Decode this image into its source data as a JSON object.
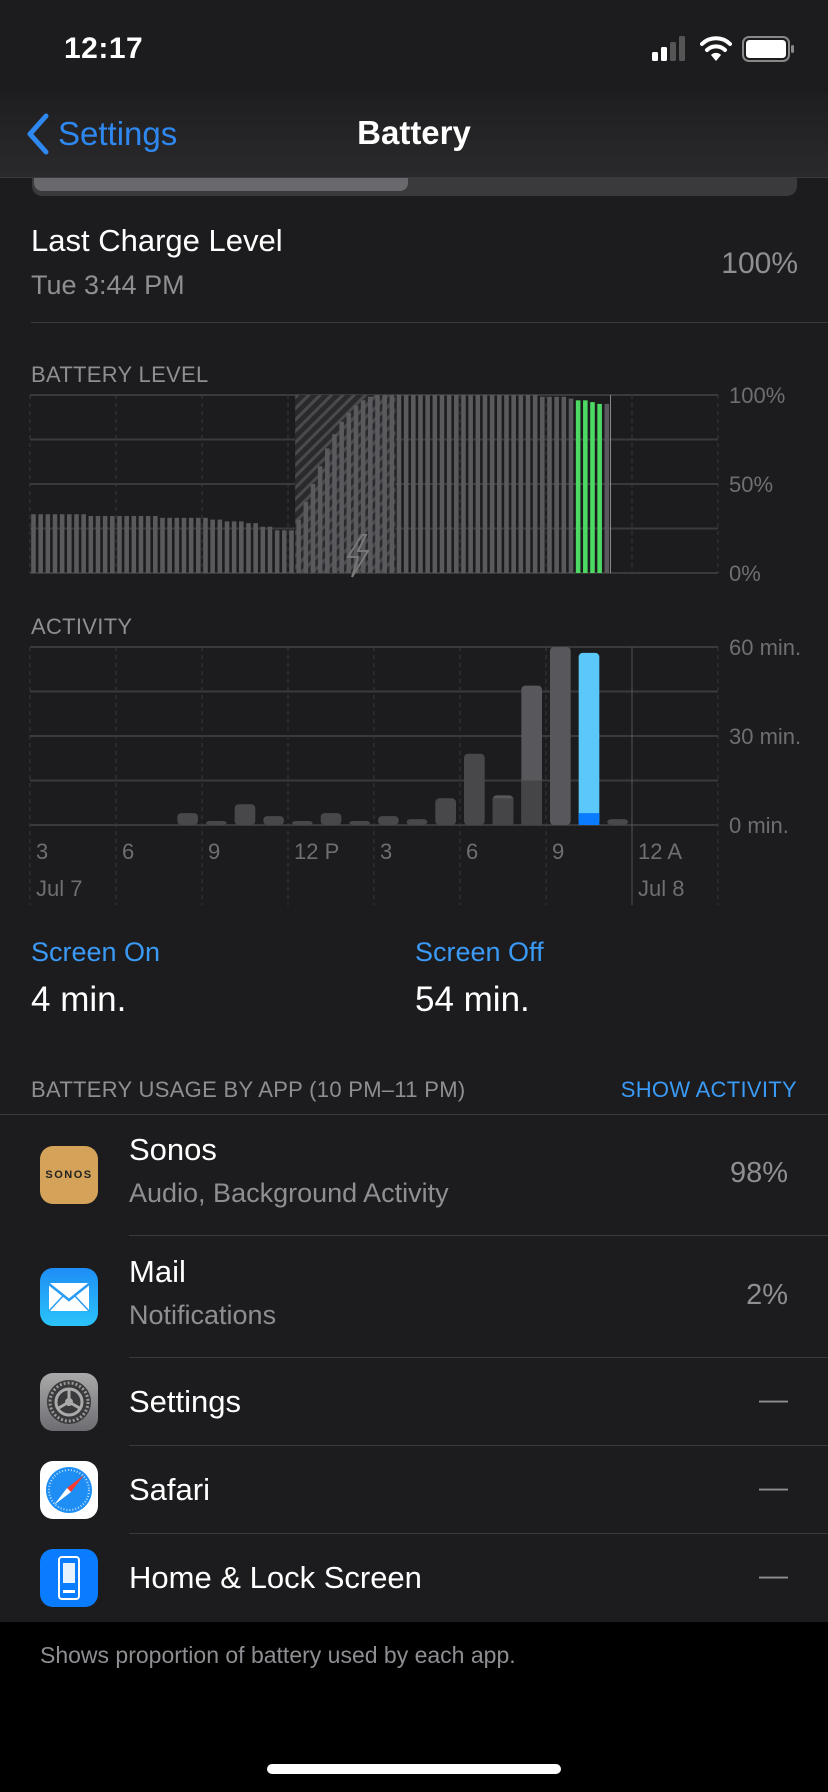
{
  "status_bar": {
    "time": "12:17",
    "icons": [
      "cellular-signal-icon",
      "wifi-icon",
      "battery-icon"
    ]
  },
  "nav": {
    "back_label": "Settings",
    "title": "Battery"
  },
  "last_charge": {
    "title": "Last Charge Level",
    "subtitle": "Tue 3:44 PM",
    "value": "100%"
  },
  "battery_level": {
    "label": "BATTERY LEVEL"
  },
  "activity": {
    "label": "ACTIVITY"
  },
  "colors": {
    "accent": "#3a9af5",
    "green": "#4cd964",
    "screen_on_selected": "#0a7cff",
    "screen_off_selected": "#5ac8fa",
    "bar_gray": "#5a5a5e"
  },
  "chart_data": [
    {
      "type": "bar",
      "title": "BATTERY LEVEL",
      "interval": "15 min",
      "x_start": "3 AM Jul 7",
      "ylim": [
        0,
        100
      ],
      "yticks": [
        "100%",
        "50%",
        "0%"
      ],
      "charging_period": [
        "12:15 PM",
        "3:45 PM"
      ],
      "selected_hour": "10 PM",
      "values": [
        33,
        33,
        33,
        33,
        33,
        33,
        33,
        33,
        32,
        32,
        32,
        32,
        32,
        32,
        32,
        32,
        32,
        32,
        31,
        31,
        31,
        31,
        31,
        31,
        31,
        30,
        30,
        29,
        29,
        29,
        28,
        28,
        26,
        26,
        24,
        24,
        24,
        30,
        40,
        50,
        60,
        70,
        78,
        85,
        90,
        94,
        97,
        99,
        100,
        100,
        100,
        100,
        100,
        100,
        100,
        100,
        100,
        100,
        100,
        100,
        100,
        100,
        100,
        100,
        100,
        100,
        100,
        100,
        100,
        100,
        100,
        99,
        99,
        99,
        99,
        98,
        97,
        97,
        96,
        95,
        95
      ]
    },
    {
      "type": "bar",
      "title": "ACTIVITY",
      "ylim": [
        0,
        60
      ],
      "yticks": [
        "60 min.",
        "30 min.",
        "0 min."
      ],
      "xticks": [
        "3",
        "6",
        "9",
        "12 P",
        "3",
        "6",
        "9",
        "12 A"
      ],
      "date_labels": [
        "Jul 7",
        "Jul 8"
      ],
      "hours": [
        "3 AM",
        "4 AM",
        "5 AM",
        "6 AM",
        "7 AM",
        "8 AM",
        "9 AM",
        "10 AM",
        "11 AM",
        "12 PM",
        "1 PM",
        "2 PM",
        "3 PM",
        "4 PM",
        "5 PM",
        "6 PM",
        "7 PM",
        "8 PM",
        "9 PM",
        "10 PM",
        "11 PM",
        "12 AM",
        "1 AM",
        "2 AM"
      ],
      "series": [
        {
          "name": "Screen On",
          "values": [
            0,
            0,
            0,
            0,
            0,
            4,
            1,
            7,
            3,
            1,
            4,
            1,
            3,
            2,
            9,
            24,
            9,
            15,
            0,
            4,
            2,
            0,
            0,
            0
          ]
        },
        {
          "name": "Screen Off",
          "values": [
            0,
            0,
            0,
            0,
            0,
            0,
            0,
            0,
            0,
            0,
            0,
            0,
            0,
            0,
            0,
            0,
            1,
            32,
            60,
            54,
            0,
            0,
            0,
            0
          ]
        }
      ],
      "selected_hour": "10 PM"
    }
  ],
  "summary": {
    "screen_on_label": "Screen On",
    "screen_on_value": "4 min.",
    "screen_off_label": "Screen Off",
    "screen_off_value": "54 min."
  },
  "usage": {
    "header": "BATTERY USAGE BY APP (10 PM–11 PM)",
    "toggle": "SHOW ACTIVITY",
    "apps": [
      {
        "name": "Sonos",
        "detail": "Audio, Background Activity",
        "value": "98%",
        "icon": "sonos-icon",
        "icon_text": "SONOS"
      },
      {
        "name": "Mail",
        "detail": "Notifications",
        "value": "2%",
        "icon": "mail-icon"
      },
      {
        "name": "Settings",
        "value": "—",
        "icon": "settings-gear-icon"
      },
      {
        "name": "Safari",
        "value": "—",
        "icon": "safari-compass-icon"
      },
      {
        "name": "Home & Lock Screen",
        "value": "—",
        "icon": "home-lock-screen-icon"
      }
    ],
    "footer": "Shows proportion of battery used by each app."
  }
}
